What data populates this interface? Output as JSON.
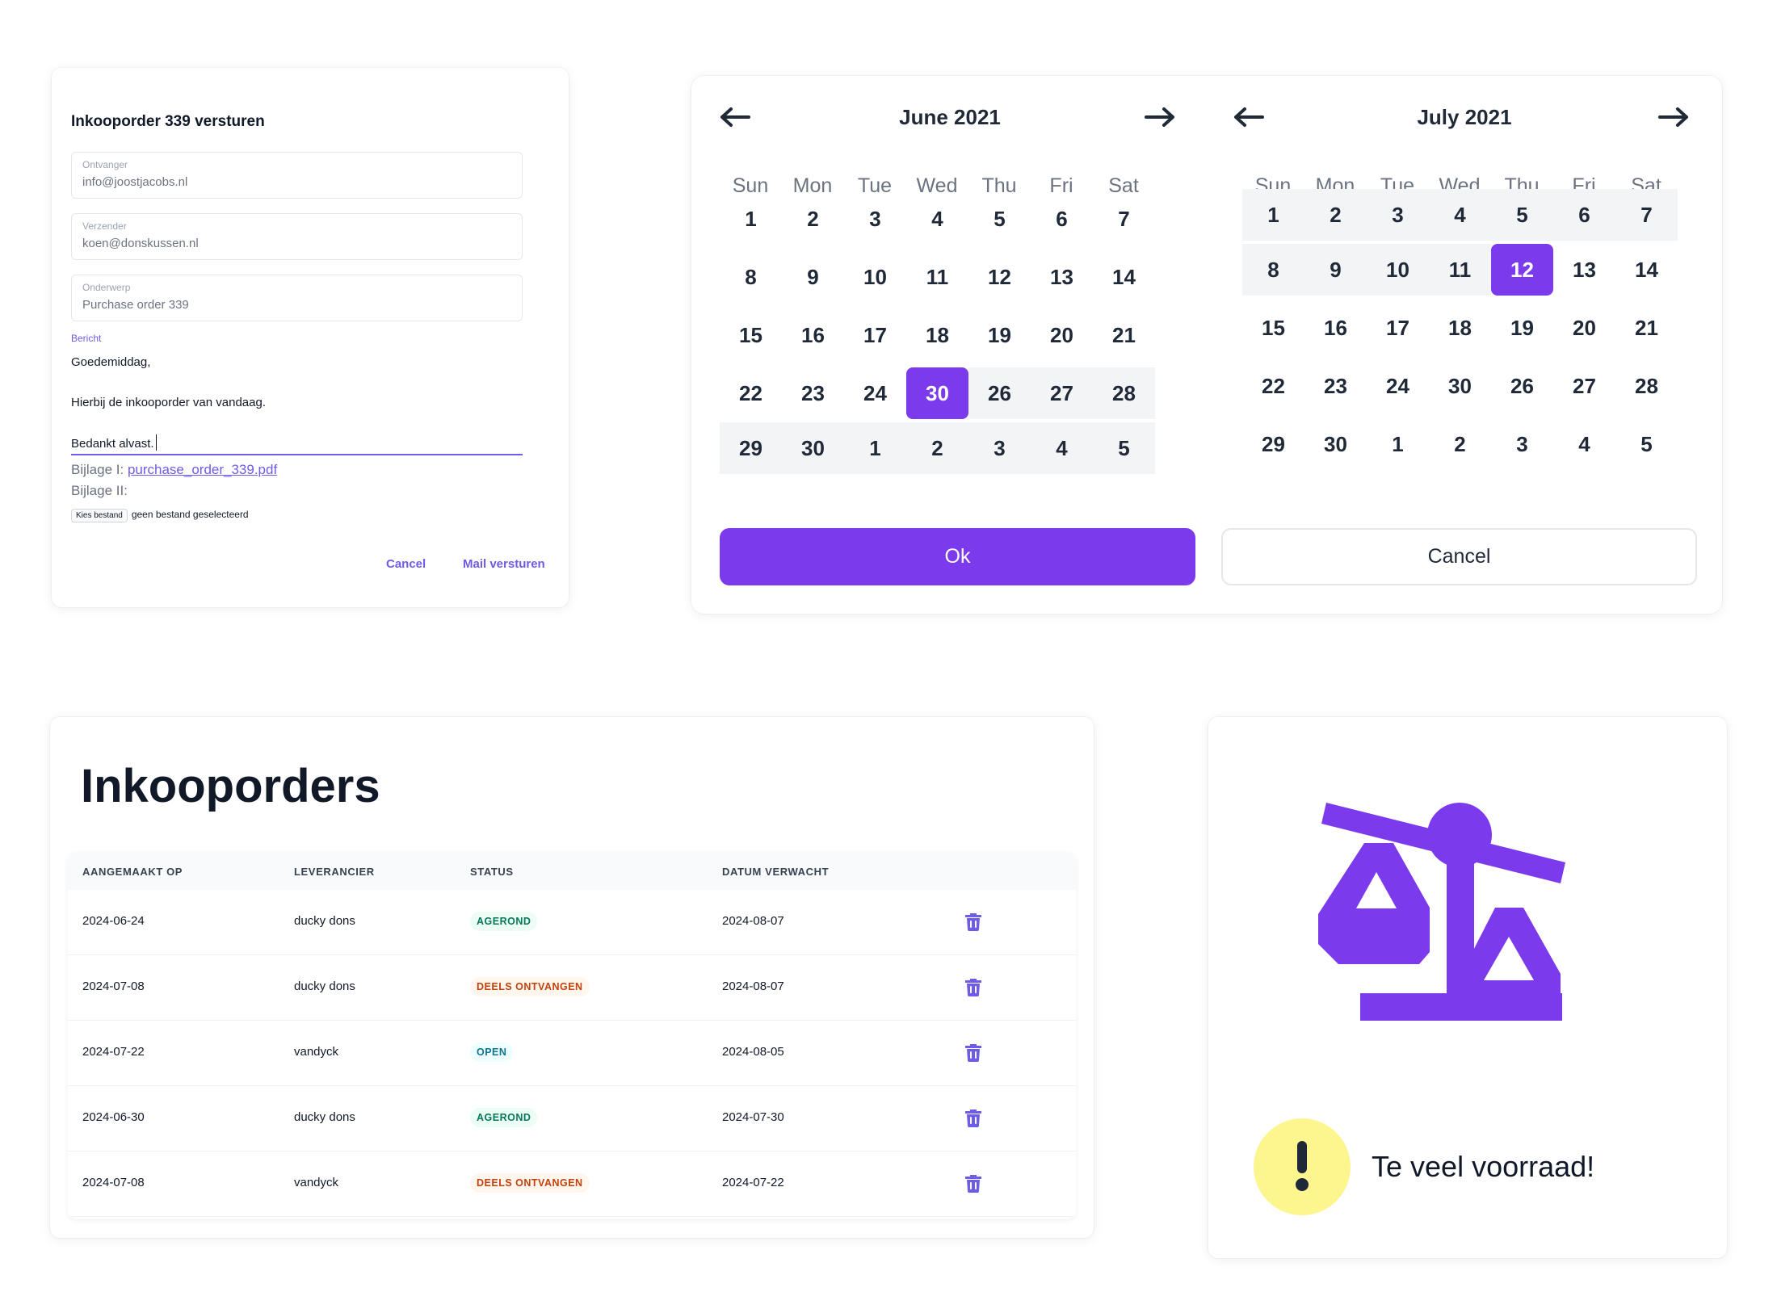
{
  "mail_dialog": {
    "title": "Inkooporder 339 versturen",
    "fields": [
      {
        "label": "Ontvanger",
        "value": "info@joostjacobs.nl"
      },
      {
        "label": "Verzender",
        "value": "koen@donskussen.nl"
      },
      {
        "label": "Onderwerp",
        "value": "Purchase order 339"
      }
    ],
    "message_label": "Bericht",
    "message_lines": [
      "Goedemiddag,",
      "Hierbij de inkooporder van vandaag.",
      "Bedankt alvast."
    ],
    "attachment_1_label": "Bijlage I:",
    "attachment_1_file": "purchase_order_339.pdf",
    "attachment_2_label": "Bijlage II:",
    "file_button": "Kies bestand",
    "file_status": "geen bestand geselecteerd",
    "cancel": "Cancel",
    "send": "Mail versturen"
  },
  "date_picker": {
    "weekdays": [
      "Sun",
      "Mon",
      "Tue",
      "Wed",
      "Thu",
      "Fri",
      "Sat"
    ],
    "months": [
      {
        "title": "June 2021",
        "weeks": [
          [
            "1",
            "2",
            "3",
            "4",
            "5",
            "6",
            "7"
          ],
          [
            "8",
            "9",
            "10",
            "11",
            "12",
            "13",
            "14"
          ],
          [
            "15",
            "16",
            "17",
            "18",
            "19",
            "20",
            "21"
          ],
          [
            "22",
            "23",
            "24",
            "30",
            "26",
            "27",
            "28"
          ],
          [
            "29",
            "30",
            "1",
            "2",
            "3",
            "4",
            "5"
          ]
        ]
      },
      {
        "title": "July 2021",
        "weeks": [
          [
            "1",
            "2",
            "3",
            "4",
            "5",
            "6",
            "7"
          ],
          [
            "8",
            "9",
            "10",
            "11",
            "12",
            "13",
            "14"
          ],
          [
            "15",
            "16",
            "17",
            "18",
            "19",
            "20",
            "21"
          ],
          [
            "22",
            "23",
            "24",
            "30",
            "26",
            "27",
            "28"
          ],
          [
            "29",
            "30",
            "1",
            "2",
            "3",
            "4",
            "5"
          ]
        ]
      }
    ],
    "ok": "Ok",
    "cancel": "Cancel",
    "accent": "#7c3aed"
  },
  "purchase_orders": {
    "title": "Inkooporders",
    "columns": [
      "AANGEMAAKT OP",
      "LEVERANCIER",
      "STATUS",
      "DATUM VERWACHT"
    ],
    "rows": [
      {
        "created": "2024-06-24",
        "supplier": "ducky dons",
        "status": "AGEROND",
        "expected": "2024-08-07"
      },
      {
        "created": "2024-07-08",
        "supplier": "ducky dons",
        "status": "DEELS ONTVANGEN",
        "expected": "2024-08-07"
      },
      {
        "created": "2024-07-22",
        "supplier": "vandyck",
        "status": "OPEN",
        "expected": "2024-08-05"
      },
      {
        "created": "2024-06-30",
        "supplier": "ducky dons",
        "status": "AGEROND",
        "expected": "2024-07-30"
      },
      {
        "created": "2024-07-08",
        "supplier": "vandyck",
        "status": "DEELS ONTVANGEN",
        "expected": "2024-07-22"
      }
    ],
    "row_icon": "trash-icon"
  },
  "stock_warning": {
    "icon": "scale-icon",
    "alert_icon": "exclamation-icon",
    "text": "Te veel voorraad!",
    "accent": "#7c3aed",
    "alert_color": "#fdf68f"
  }
}
